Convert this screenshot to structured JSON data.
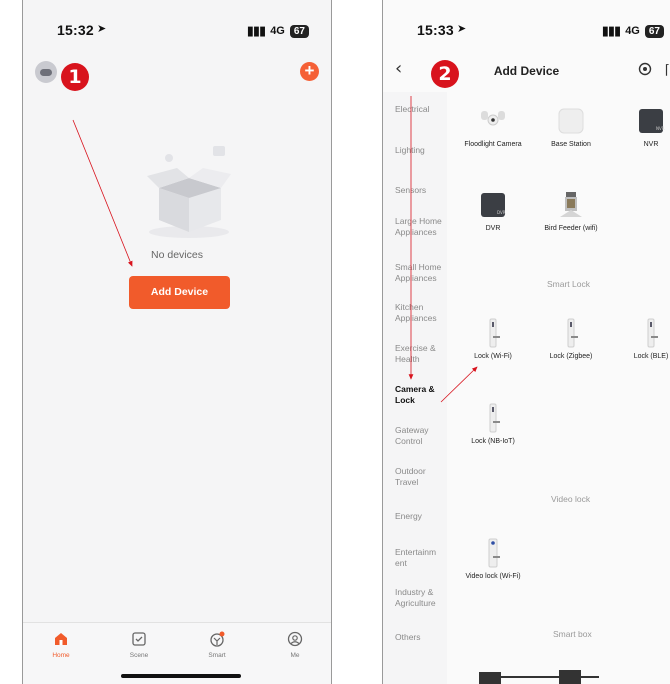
{
  "phone1": {
    "status": {
      "time": "15:32",
      "network": "4G",
      "battery": "67"
    },
    "badge": "1",
    "empty_text": "No devices",
    "add_button": "Add Device",
    "tabs": [
      {
        "label": "Home",
        "icon": "home-icon",
        "active": true
      },
      {
        "label": "Scene",
        "icon": "scene-icon",
        "active": false
      },
      {
        "label": "Smart",
        "icon": "smart-icon",
        "active": false
      },
      {
        "label": "Me",
        "icon": "me-icon",
        "active": false
      }
    ],
    "accent": "#f15b2b"
  },
  "phone2": {
    "status": {
      "time": "15:33",
      "network": "4G",
      "battery": "67"
    },
    "badge": "2",
    "title": "Add Device",
    "categories": [
      "Electrical",
      "Lighting",
      "Sensors",
      "Large Home Appliances",
      "Small Home Appliances",
      "Kitchen Appliances",
      "Exercise & Health",
      "Camera & Lock",
      "Gateway Control",
      "Outdoor Travel",
      "Energy",
      "Entertainm ent",
      "Industry & Agriculture",
      "Others"
    ],
    "active_category": "Camera & Lock",
    "devices": {
      "floodlight": "Floodlight Camera",
      "base_station": "Base Station",
      "nvr": "NVR",
      "dvr": "DVR",
      "bird_feeder": "Bird Feeder (wifi)",
      "lock_wifi": "Lock (Wi-Fi)",
      "lock_zigbee": "Lock (Zigbee)",
      "lock_ble": "Lock (BLE)",
      "lock_nbiot": "Lock (NB-IoT)",
      "video_lock": "Video lock (Wi-Fi)"
    },
    "sections": {
      "smart_lock": "Smart Lock",
      "video_lock": "Video lock",
      "smart_box": "Smart box"
    }
  },
  "colors": {
    "badge": "#d8131d",
    "arrow": "#d8131d"
  }
}
